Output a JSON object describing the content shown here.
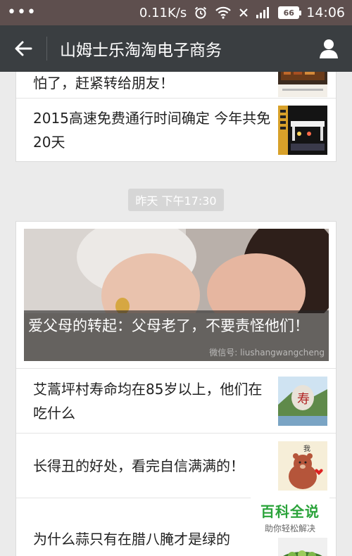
{
  "status_bar": {
    "network_speed": "0.11K/s",
    "battery": "66",
    "time": "14:06"
  },
  "header": {
    "title": "山姆士乐淘淘电子商务"
  },
  "top_card": {
    "items": [
      {
        "text": "怕了，赶紧转给朋友！"
      },
      {
        "text": "2015高速免费通行时间确定 今年共免20天"
      }
    ]
  },
  "timestamp": "昨天 下午17:30",
  "main_card": {
    "hero_caption": "爱父母的转起：父母老了，不要责怪他们！",
    "hero_watermark": "微信号: liushangwangcheng",
    "items": [
      {
        "text": "艾蒿坪村寿命均在85岁以上，他们在吃什么"
      },
      {
        "text": "长得丑的好处，看完自信满满的！"
      },
      {
        "text": "为什么蒜只有在腊八腌才是绿的"
      }
    ]
  },
  "watermark": {
    "title": "百科全说",
    "subtitle": "助你轻松解决"
  }
}
